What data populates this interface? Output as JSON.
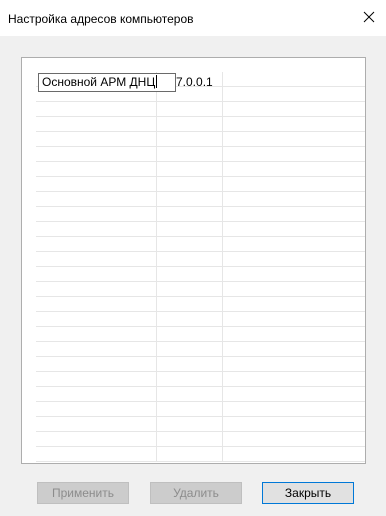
{
  "window": {
    "title": "Настройка адресов компьютеров",
    "close_glyph": "✕"
  },
  "grid": {
    "rows": [
      {
        "name": "Основной АРМ ДНЦ",
        "ip": "7.0.0.1"
      }
    ]
  },
  "buttons": {
    "apply": "Применить",
    "delete": "Удалить",
    "close": "Закрыть"
  }
}
